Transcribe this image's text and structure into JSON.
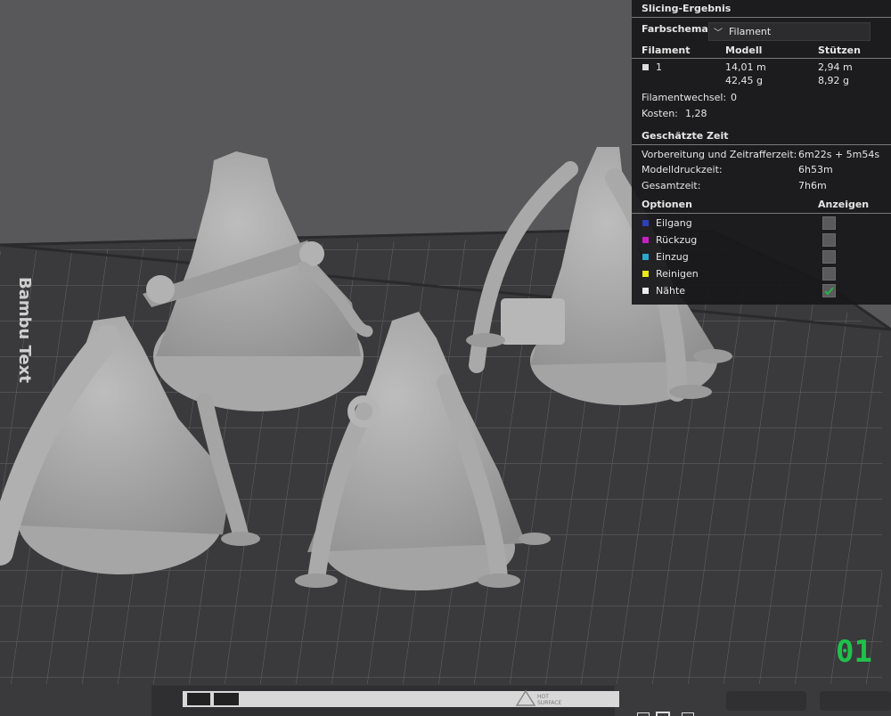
{
  "panel": {
    "title": "Slicing-Ergebnis",
    "color_scheme_label": "Farbschema",
    "color_scheme_value": "Filament",
    "table_headers": [
      "Filament",
      "Modell",
      "Stützen"
    ],
    "filament_id": "1",
    "model_length": "14,01 m",
    "model_weight": "42,45 g",
    "support_length": "2,94 m",
    "support_weight": "8,92 g",
    "filament_change_label": "Filamentwechsel:",
    "filament_change_value": "0",
    "cost_label": "Kosten:",
    "cost_value": "1,28",
    "time_header": "Geschätzte Zeit",
    "prep_label": "Vorbereitung und Zeitrafferzeit:",
    "prep_value": "6m22s + 5m54s",
    "print_label": "Modelldruckzeit:",
    "print_value": "6h53m",
    "total_label": "Gesamtzeit:",
    "total_value": "7h6m",
    "options_header": "Optionen",
    "show_header": "Anzeigen",
    "options": [
      {
        "label": "Eilgang",
        "color": "#2e3fb8",
        "checked": false
      },
      {
        "label": "Rückzug",
        "color": "#c81ec8",
        "checked": false
      },
      {
        "label": "Einzug",
        "color": "#2aa8d0",
        "checked": false
      },
      {
        "label": "Reinigen",
        "color": "#e8e81a",
        "checked": false
      },
      {
        "label": "Nähte",
        "color": "#eeeeee",
        "checked": true
      }
    ]
  },
  "bed": {
    "brand_text": "Bambu Text",
    "hot_surface_label": "HOT SURFACE",
    "plate_number": "01"
  }
}
